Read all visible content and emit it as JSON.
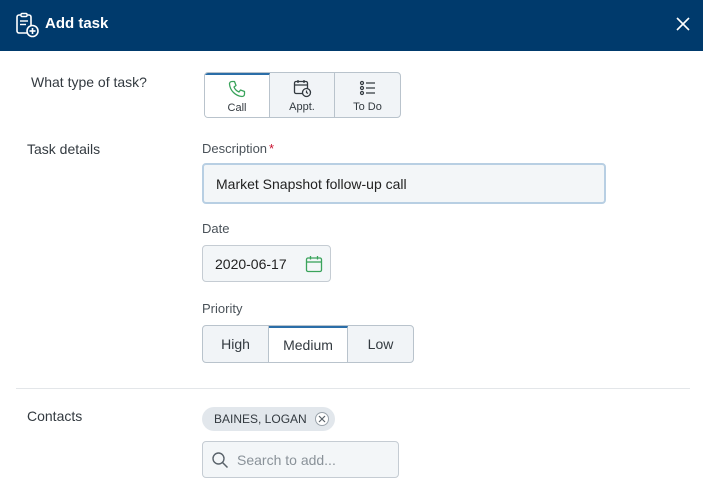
{
  "header": {
    "title": "Add task",
    "icon": "task-add-icon",
    "close_icon": "close-icon",
    "bg": "#003a6c"
  },
  "task_type": {
    "label": "What type of task?",
    "options": [
      {
        "label": "Call",
        "icon": "phone-icon",
        "selected": true
      },
      {
        "label": "Appt.",
        "icon": "calendar-clock-icon",
        "selected": false
      },
      {
        "label": "To Do",
        "icon": "list-icon",
        "selected": false
      }
    ]
  },
  "task_details": {
    "label": "Task details",
    "description": {
      "label": "Description",
      "required_marker": "*",
      "value": "Market Snapshot follow-up call"
    },
    "date": {
      "label": "Date",
      "value": "2020-06-17",
      "icon": "calendar-icon"
    },
    "priority": {
      "label": "Priority",
      "options": [
        {
          "label": "High",
          "selected": false
        },
        {
          "label": "Medium",
          "selected": true
        },
        {
          "label": "Low",
          "selected": false
        }
      ]
    }
  },
  "contacts": {
    "label": "Contacts",
    "chips": [
      {
        "label": "BAINES, LOGAN"
      }
    ],
    "search_placeholder": "Search to add..."
  },
  "colors": {
    "accent": "#2b6ea8",
    "green_icon": "#3aa35b",
    "required": "#c8102e"
  }
}
